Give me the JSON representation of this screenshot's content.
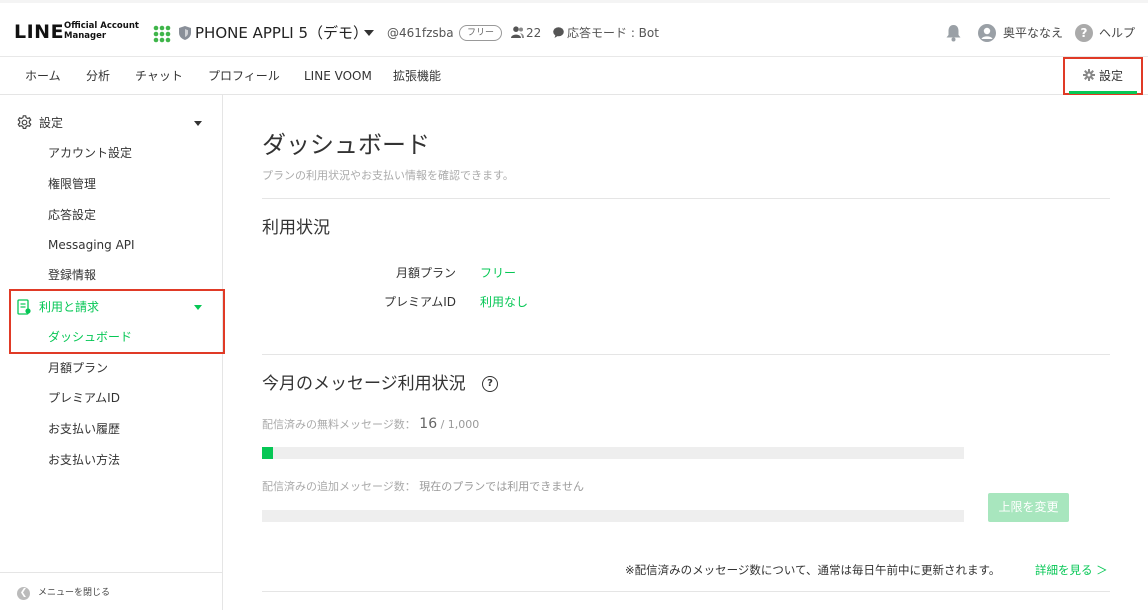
{
  "header": {
    "logo_main": "LINE",
    "logo_sub_1": "Official Account",
    "logo_sub_2": "Manager",
    "account_name": "PHONE APPLI 5（デモ）",
    "account_id": "@461fzsba",
    "plan_badge": "フリー",
    "friends_count": "22",
    "response_mode": "応答モード : Bot",
    "user_name": "奥平ななえ",
    "help_label": "ヘルプ"
  },
  "nav": {
    "items": [
      "ホーム",
      "分析",
      "チャット",
      "プロフィール",
      "LINE VOOM",
      "拡張機能"
    ],
    "settings_label": "設定"
  },
  "sidebar": {
    "settings_group": "設定",
    "settings_items": [
      "アカウント設定",
      "権限管理",
      "応答設定",
      "Messaging API",
      "登録情報"
    ],
    "billing_group": "利用と請求",
    "billing_items": [
      "ダッシュボード",
      "月額プラン",
      "プレミアムID",
      "お支払い履歴",
      "お支払い方法"
    ],
    "collapse_label": "メニューを閉じる"
  },
  "main": {
    "title": "ダッシュボード",
    "subtitle": "プランの利用状況やお支払い情報を確認できます。",
    "usage_title": "利用状況",
    "monthly_plan_label": "月額プラン",
    "monthly_plan_value": "フリー",
    "premium_id_label": "プレミアムID",
    "premium_id_value": "利用なし",
    "messages_title": "今月のメッセージ利用状況",
    "free_label": "配信済みの無料メッセージ数：",
    "free_used": "16",
    "free_total": " / 1,000",
    "free_progress": 0.016,
    "additional_label": "配信済みの追加メッセージ数：",
    "additional_value": "現在のプランでは利用できません",
    "additional_progress": 0,
    "limit_button": "上限を変更",
    "note": "※配信済みのメッセージ数について、通常は毎日午前中に更新されます。",
    "detail_link": "詳細を見る ＞"
  },
  "colors": {
    "brand_green": "#06c755",
    "highlight_red": "#e03a26"
  }
}
